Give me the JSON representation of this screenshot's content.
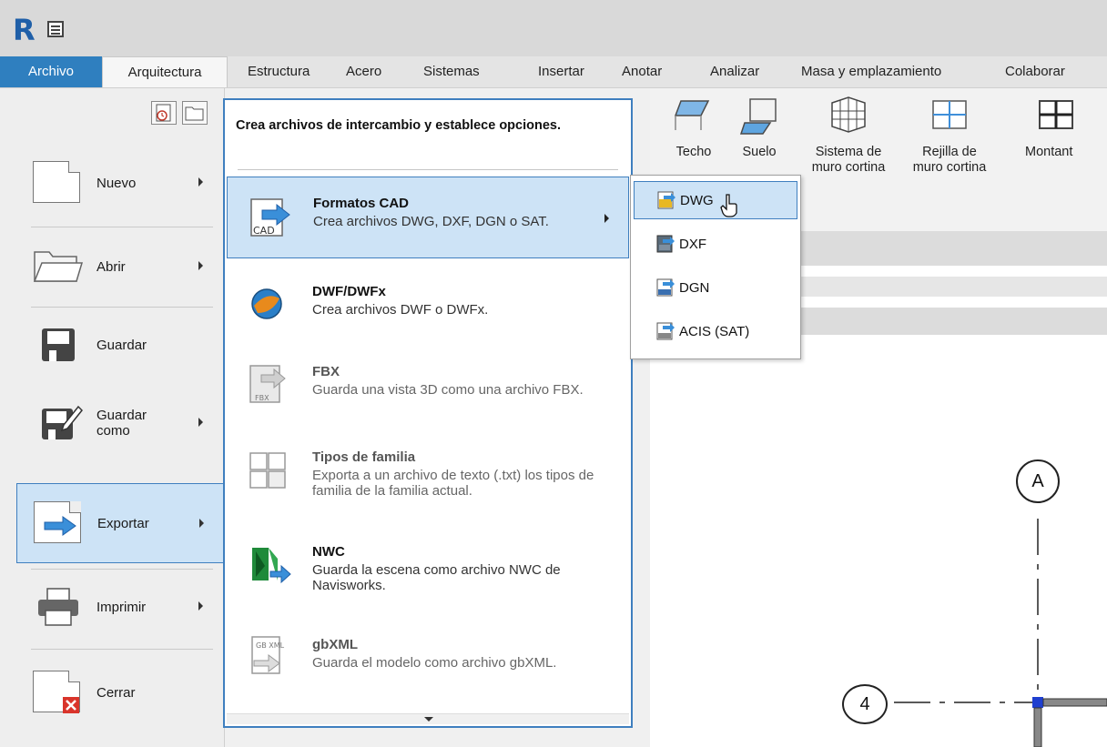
{
  "app": {
    "logo": "R",
    "quick_access_icon": "properties-icon"
  },
  "tabs": [
    {
      "label": "Archivo",
      "active": true
    },
    {
      "label": "Arquitectura"
    },
    {
      "label": "Estructura"
    },
    {
      "label": "Acero"
    },
    {
      "label": "Sistemas"
    },
    {
      "label": "Insertar"
    },
    {
      "label": "Anotar"
    },
    {
      "label": "Analizar"
    },
    {
      "label": "Masa y emplazamiento"
    },
    {
      "label": "Colaborar"
    }
  ],
  "ribbon": {
    "buttons": [
      {
        "label": "Techo",
        "icon": "ceiling-icon"
      },
      {
        "label": "Suelo",
        "icon": "floor-icon"
      },
      {
        "label1": "Sistema de",
        "label2": "muro cortina",
        "icon": "curtain-system-icon"
      },
      {
        "label1": "Rejilla de",
        "label2": "muro cortina",
        "icon": "curtain-grid-icon"
      },
      {
        "label": "Montant",
        "icon": "mullion-icon"
      }
    ]
  },
  "left_menu": {
    "items": [
      {
        "label": "Nuevo",
        "icon": "new-document-icon",
        "has_submenu": true
      },
      {
        "label": "Abrir",
        "icon": "open-folder-icon",
        "has_submenu": true
      },
      {
        "label": "Guardar",
        "icon": "save-icon",
        "has_submenu": false
      },
      {
        "label1": "Guardar",
        "label2": "como",
        "icon": "save-as-icon",
        "has_submenu": true
      },
      {
        "label": "Exportar",
        "icon": "export-icon",
        "has_submenu": true,
        "selected": true
      },
      {
        "label": "Imprimir",
        "icon": "print-icon",
        "has_submenu": true
      },
      {
        "label": "Cerrar",
        "icon": "close-document-icon",
        "has_submenu": false
      }
    ]
  },
  "export_panel": {
    "header": "Crea archivos de intercambio y establece opciones.",
    "items": [
      {
        "title": "Formatos CAD",
        "desc": "Crea archivos DWG, DXF, DGN o SAT.",
        "icon": "cad-icon",
        "icon_text": "CAD",
        "selected": true
      },
      {
        "title": "DWF/DWFx",
        "desc": "Crea archivos DWF o DWFx.",
        "icon": "dwf-globe-icon"
      },
      {
        "title": "FBX",
        "desc": "Guarda una vista 3D como una archivo FBX.",
        "icon": "fbx-icon",
        "icon_text": "FBX",
        "dimmed": true
      },
      {
        "title": "Tipos de familia",
        "desc": "Exporta a un archivo de texto (.txt) los tipos de familia de la familia actual.",
        "icon": "family-types-icon",
        "dimmed": true
      },
      {
        "title": "NWC",
        "desc": "Guarda la escena como archivo NWC de Navisworks.",
        "icon": "navisworks-icon"
      },
      {
        "title": "gbXML",
        "desc": "Guarda el modelo como archivo gbXML.",
        "icon": "gbxml-icon",
        "icon_text": "GB XML",
        "dimmed": true
      }
    ]
  },
  "cad_submenu": {
    "items": [
      {
        "label": "DWG",
        "icon": "dwg-icon",
        "hovered": true
      },
      {
        "label": "DXF",
        "icon": "dxf-icon"
      },
      {
        "label": "DGN",
        "icon": "dgn-icon"
      },
      {
        "label": "ACIS (SAT)",
        "icon": "sat-icon"
      }
    ]
  },
  "drawing": {
    "grid_labels": [
      "A",
      "4"
    ]
  },
  "colors": {
    "accent": "#2f7fbf",
    "selection_bg": "#cde3f6",
    "selection_border": "#3f7fbf"
  }
}
